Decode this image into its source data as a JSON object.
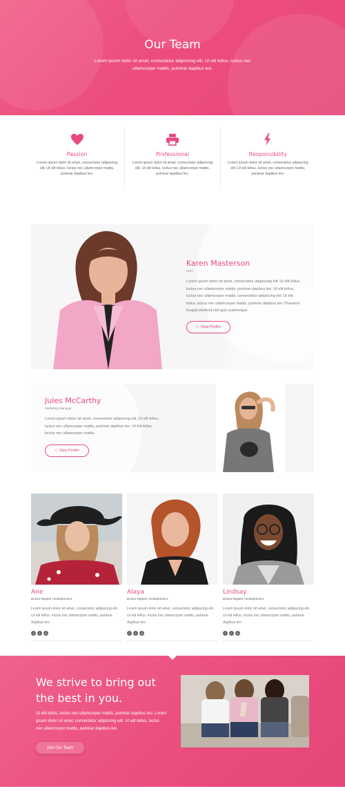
{
  "hero": {
    "title": "Our Team",
    "subtitle": "Lorem ipsum dolor sit amet, consectetur adipiscing elit. Ut elit tellus, luctus nec ullamcorper mattis, pulvinar dapibus leo."
  },
  "features": [
    {
      "icon": "heart-icon",
      "title": "Passion",
      "text": "Lorem ipsum dolor sit amet, consectetur adipiscing elit. Ut elit tellus, luctus nec ullamcorper mattis, pulvinar dapibus leo."
    },
    {
      "icon": "printer-icon",
      "title": "Professional",
      "text": "Lorem ipsum dolor sit amet, consectetur adipiscing elit. Ut elit tellus, luctus nec ullamcorper mattis, pulvinar dapibus leo."
    },
    {
      "icon": "lightning-icon",
      "title": "Responsibility",
      "text": "Lorem ipsum dolor sit amet, consectetur adipiscing elit. Ut elit tellus, luctus nec ullamcorper mattis, pulvinar dapibus leo."
    }
  ],
  "featured": [
    {
      "name": "Karen Masterson",
      "role": "CEO",
      "text": "Lorem ipsum dolor sit amet, consectetur adipiscing elit. Ut elit tellus, luctus nec ullamcorper mattis, pulvinar dapibus leo. Ut elit tellus, luctus nec ullamcorper mattis. consectetur adipiscing elit. Ut elit tellus, luctus nec ullamcorper mattis, pulvinar dapibus leo. Praesent feugiat eleifend nisl quis scelerisque.",
      "button": "View Profile"
    },
    {
      "name": "Jules McCarthy",
      "role": "Marketing Manager",
      "text": "Lorem ipsum dolor sit amet, consectetur adipiscing elit. Ut elit tellus, luctus nec ullamcorper mattis, pulvinar dapibus leo. Ut elit tellus, luctus nec ullamcorper mattis.",
      "button": "View Profile"
    }
  ],
  "members": [
    {
      "name": "Ane",
      "role": "Doctor Degree / Entrepreneur",
      "text": "Lorem ipsum dolor sit amet, consectetur adipiscing elit. Ut elit tellus, luctus nec ullamcorper mattis, pulvinar dapibus leo."
    },
    {
      "name": "Alaya",
      "role": "Doctor Degree / Entrepreneur",
      "text": "Lorem ipsum dolor sit amet, consectetur adipiscing elit. Ut elit tellus, luctus nec ullamcorper mattis, pulvinar dapibus leo."
    },
    {
      "name": "Lindsay",
      "role": "Doctor Degree / Entrepreneur",
      "text": "Lorem ipsum dolor sit amet, consectetur adipiscing elit. Ut elit tellus, luctus nec ullamcorper mattis, pulvinar dapibus leo."
    }
  ],
  "social_icons": [
    "facebook-icon",
    "twitter-icon",
    "linkedin-icon"
  ],
  "cta": {
    "headline_line1": "We strive to bring out",
    "headline_line2": "the best in you.",
    "text": "Ut elit tellus, luctus nec ullamcorper mattis, pulvinar dapibus leo. Lorem ipsum dolor sit amet, consectetur adipiscing elit. Ut elit tellus, luctus nec ullamcorper mattis, pulvinar dapibus leo.",
    "button": "Join Our Team"
  },
  "colors": {
    "accent": "#e84a7c",
    "hero_bg": "#ec4d7e",
    "card_bg": "#f6f6f6"
  }
}
